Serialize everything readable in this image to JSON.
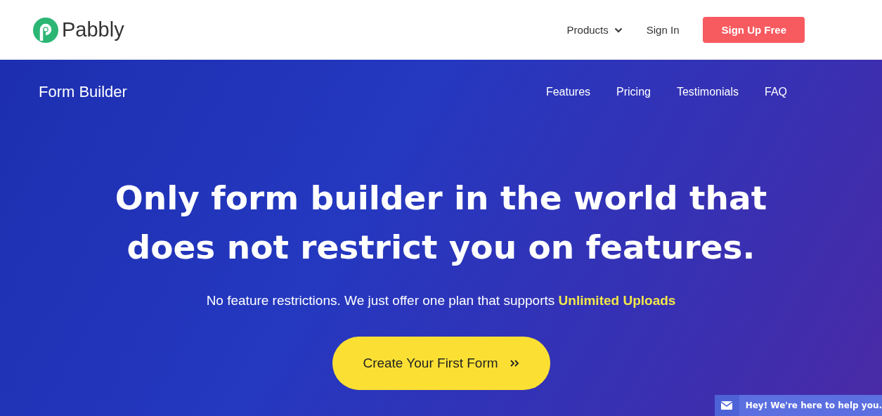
{
  "header": {
    "logo_text": "Pabbly",
    "nav": [
      {
        "label": "Products",
        "kind": "dropdown"
      },
      {
        "label": "Sign In",
        "kind": "link"
      }
    ],
    "cta": "Sign Up Free"
  },
  "hero": {
    "product_name": "Form Builder",
    "nav": [
      "Features",
      "Pricing",
      "Testimonials",
      "FAQ"
    ],
    "headline_lines": [
      "Only form builder in the world that",
      "does not restrict you on features."
    ],
    "subtitle": "No feature restrictions. We just offer one plan that supports",
    "highlight": "Unlimited Uploads",
    "button": "Create Your First Form"
  },
  "chat_widget": {
    "text": "Hey! We're here to help you."
  }
}
